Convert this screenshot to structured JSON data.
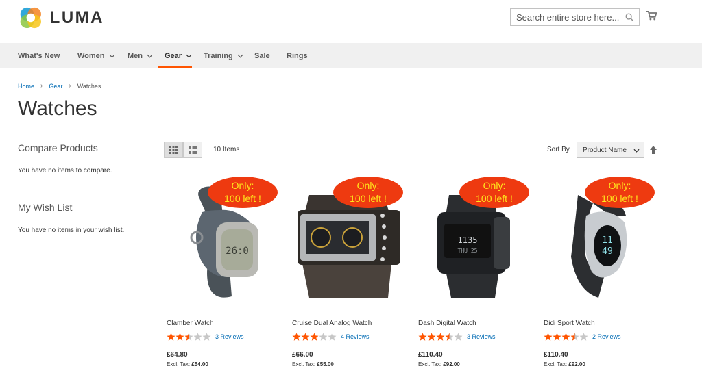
{
  "brand": {
    "name": "LUMA"
  },
  "search": {
    "placeholder": "Search entire store here..."
  },
  "nav": {
    "items": [
      {
        "label": "What's New",
        "dropdown": false
      },
      {
        "label": "Women",
        "dropdown": true
      },
      {
        "label": "Men",
        "dropdown": true
      },
      {
        "label": "Gear",
        "dropdown": true,
        "active": true
      },
      {
        "label": "Training",
        "dropdown": true
      },
      {
        "label": "Sale",
        "dropdown": false
      },
      {
        "label": "Rings",
        "dropdown": false
      }
    ]
  },
  "breadcrumb": {
    "home": "Home",
    "gear": "Gear",
    "current": "Watches"
  },
  "page": {
    "title": "Watches"
  },
  "sidebar": {
    "compare_title": "Compare Products",
    "compare_text": "You have no items to compare.",
    "wishlist_title": "My Wish List",
    "wishlist_text": "You have no items in your wish list."
  },
  "toolbar": {
    "items_count": "10 Items",
    "sort_label": "Sort By",
    "sort_value": "Product Name"
  },
  "colors": {
    "accent": "#ff5501",
    "link": "#006bb4",
    "badge_bg": "#ee3a10",
    "badge_text": "#ffe61c",
    "star": "#ff5501"
  },
  "products": [
    {
      "name": "Clamber Watch",
      "badge_line1": "Only:",
      "badge_line2": "100 left !",
      "rating": 2.5,
      "reviews": "3  Reviews",
      "price": "£64.80",
      "excl_label": "Excl. Tax:",
      "excl_price": "£54.00"
    },
    {
      "name": "Cruise Dual Analog Watch",
      "badge_line1": "Only:",
      "badge_line2": "100 left !",
      "rating": 3,
      "reviews": "4  Reviews",
      "price": "£66.00",
      "excl_label": "Excl. Tax:",
      "excl_price": "£55.00"
    },
    {
      "name": "Dash Digital Watch",
      "badge_line1": "Only:",
      "badge_line2": "100 left !",
      "rating": 3.5,
      "reviews": "3  Reviews",
      "price": "£110.40",
      "excl_label": "Excl. Tax:",
      "excl_price": "£92.00"
    },
    {
      "name": "Didi Sport Watch",
      "badge_line1": "Only:",
      "badge_line2": "100 left !",
      "rating": 3.5,
      "reviews": "2  Reviews",
      "price": "£110.40",
      "excl_label": "Excl. Tax:",
      "excl_price": "£92.00"
    }
  ]
}
